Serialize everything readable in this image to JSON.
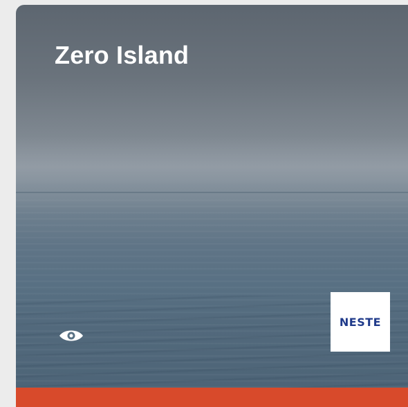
{
  "card": {
    "title": "Zero Island",
    "icons": {
      "view": "eye-icon"
    },
    "sponsor_logo_text": "NESTE",
    "colors": {
      "bottom_bar": "#d84a2b",
      "logo_text": "#1f3a8a",
      "title": "#ffffff"
    }
  }
}
